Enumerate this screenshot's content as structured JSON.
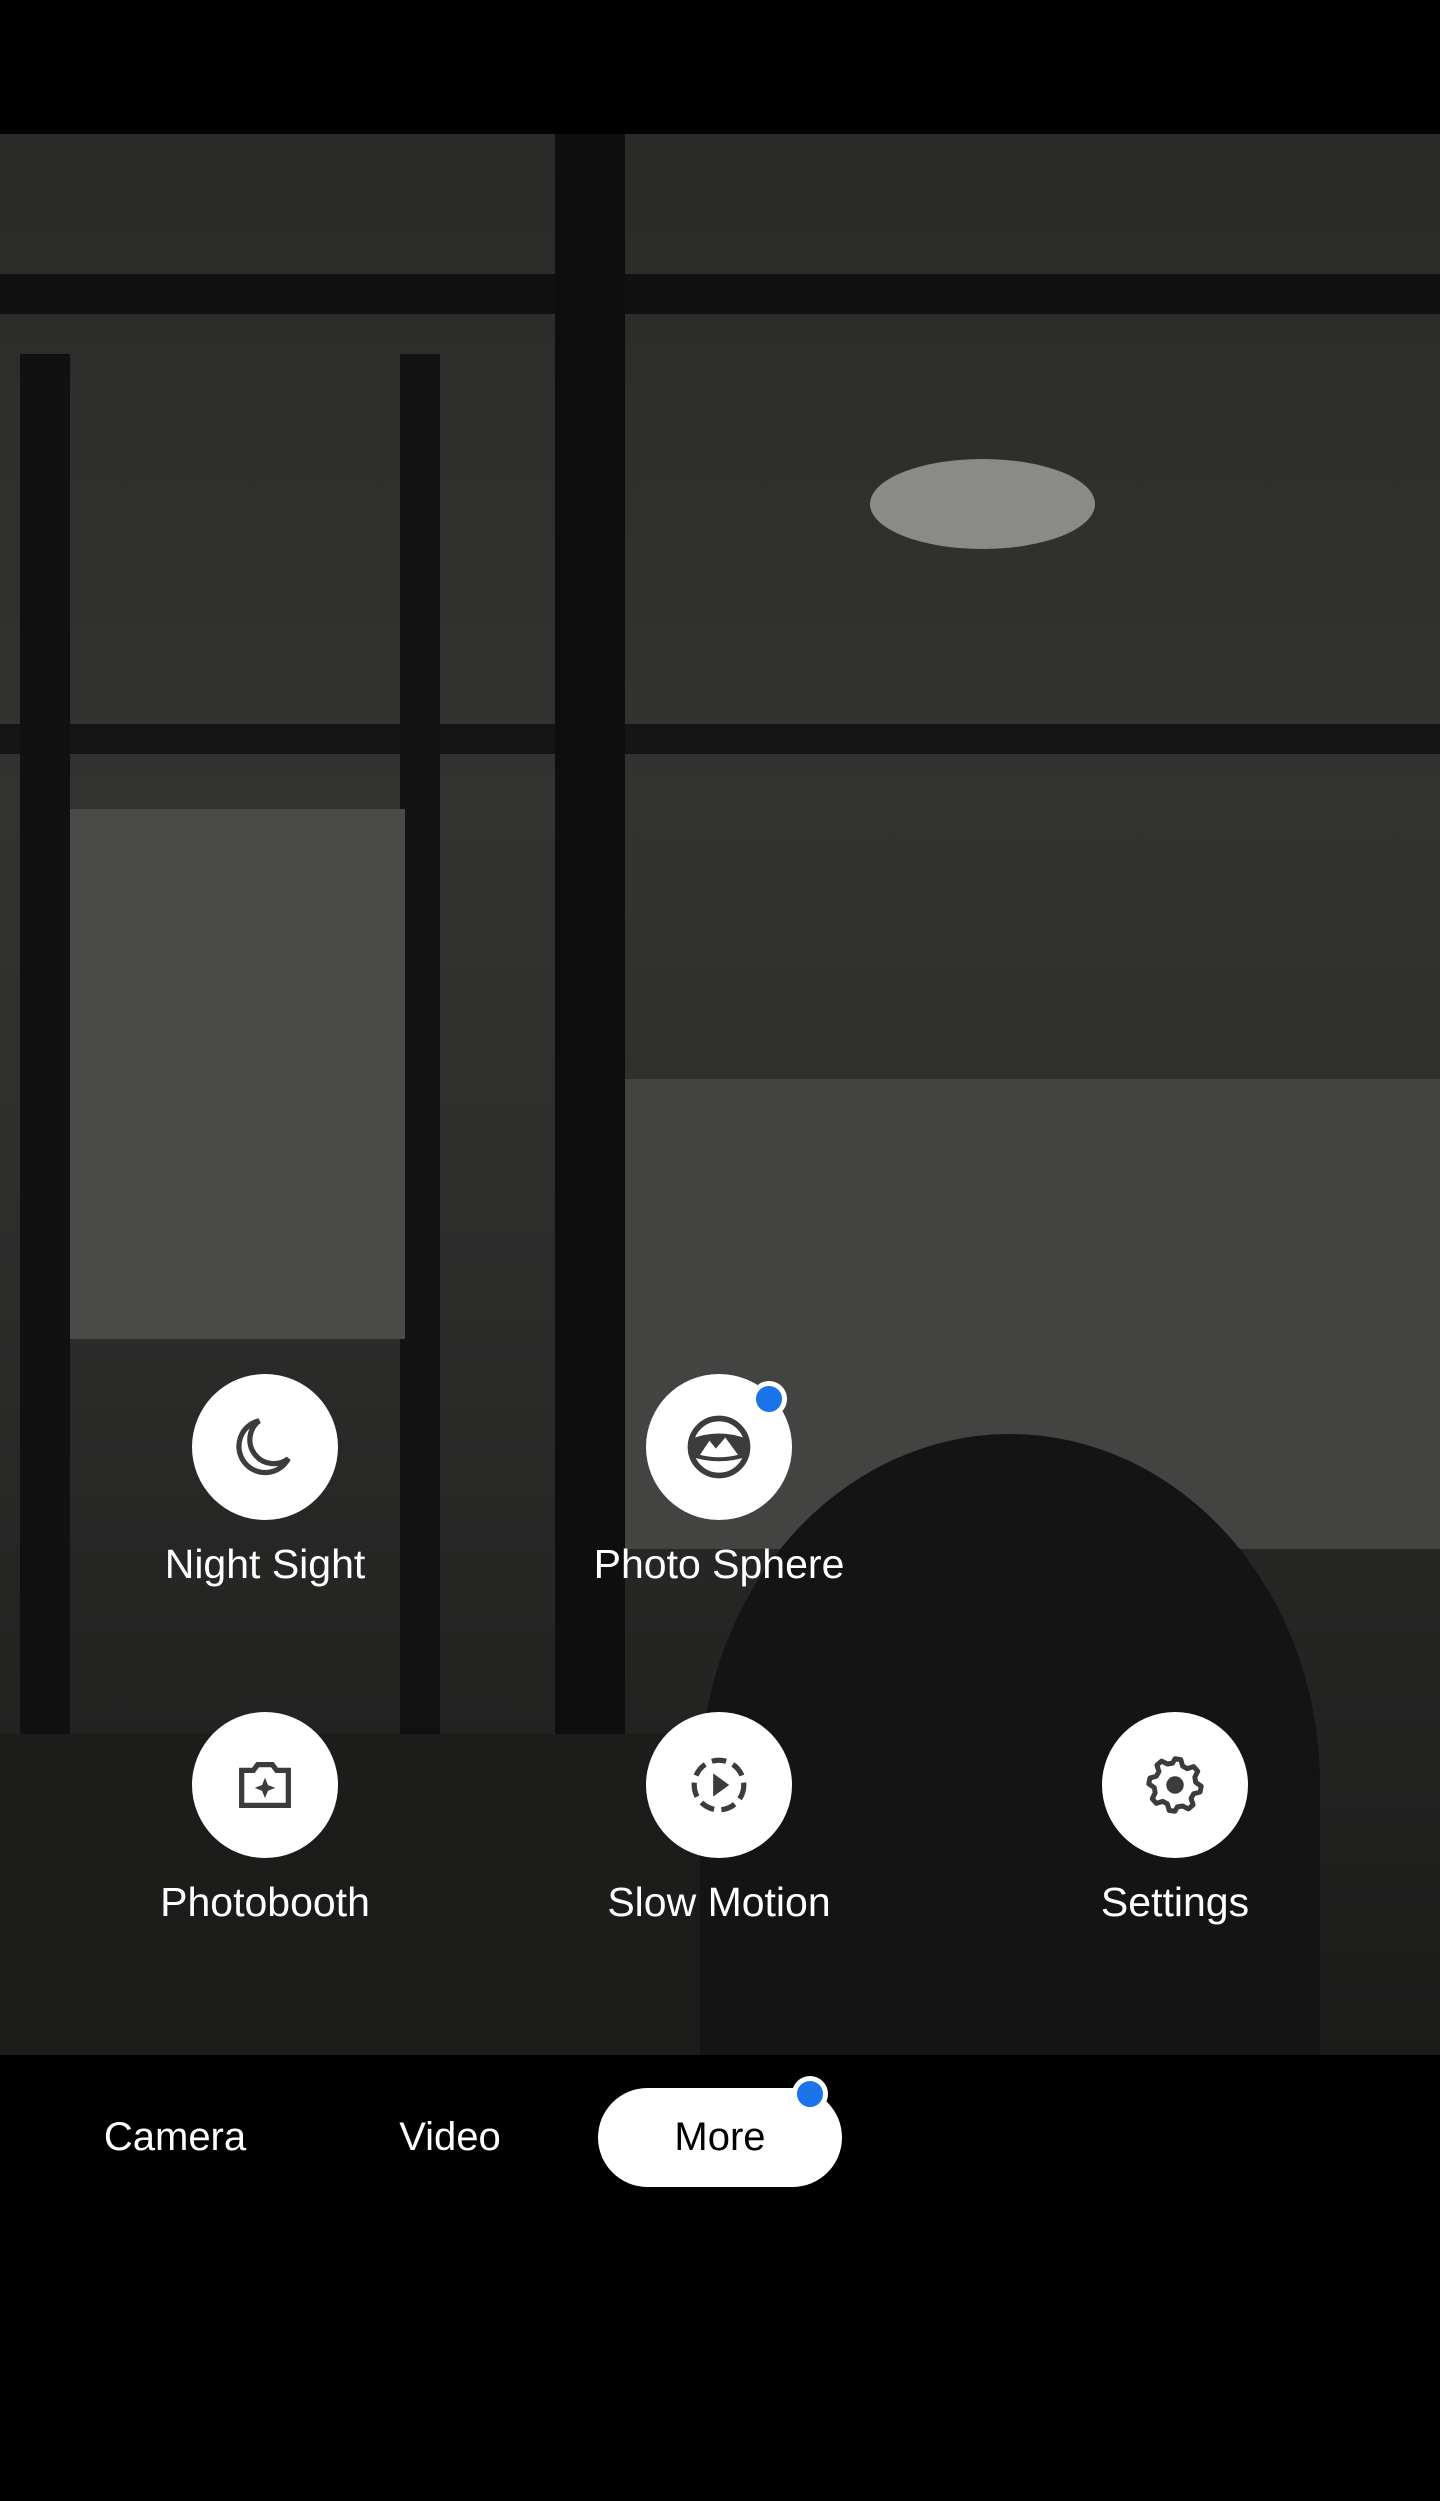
{
  "modes": [
    {
      "label": "Night Sight",
      "icon": "moon-icon",
      "badge": false
    },
    {
      "label": "Photo Sphere",
      "icon": "photo-sphere-icon",
      "badge": true
    },
    {
      "label": "Photobooth",
      "icon": "photobooth-icon",
      "badge": false
    },
    {
      "label": "Slow Motion",
      "icon": "slow-motion-icon",
      "badge": false
    },
    {
      "label": "Settings",
      "icon": "gear-icon",
      "badge": false
    }
  ],
  "tabs": [
    {
      "label": "Camera",
      "active": false
    },
    {
      "label": "Video",
      "active": false
    },
    {
      "label": "More",
      "active": true,
      "badge": true
    }
  ],
  "colors": {
    "badge": "#1a73e8",
    "icon": "#3c3c3c"
  }
}
